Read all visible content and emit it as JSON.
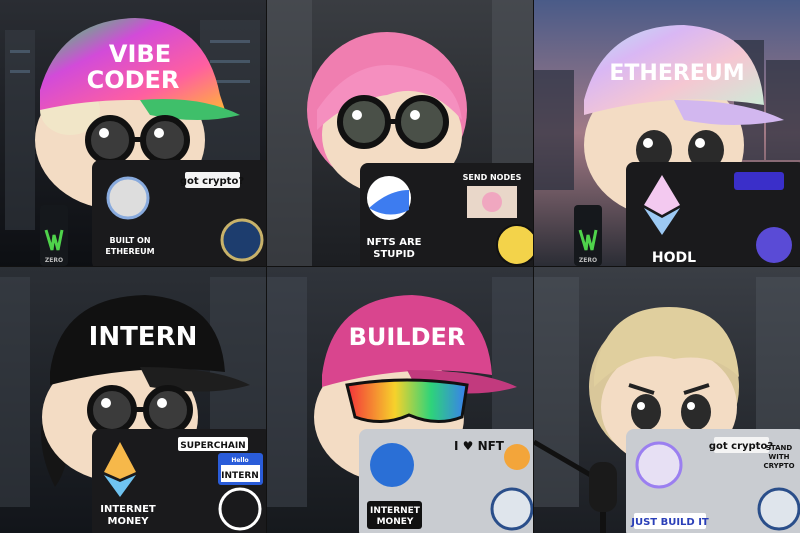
{
  "tiles": [
    {
      "hat": [
        "VIBE",
        "CODER"
      ],
      "stickers": {
        "a": "got crypto?",
        "b": [
          "BUILT ON",
          "ETHEREUM"
        ],
        "can": "ZERO"
      }
    },
    {
      "hat": [],
      "stickers": {
        "a": "SEND NODES",
        "b": [
          "NFTS ARE",
          "STUPID"
        ]
      }
    },
    {
      "hat": [
        "ETHEREUM"
      ],
      "stickers": {
        "a": "HODL",
        "can": "ZERO"
      }
    },
    {
      "hat": [
        "INTERN"
      ],
      "stickers": {
        "a": "SUPERCHAIN",
        "name": "INTERN",
        "nameHeader": "Hello",
        "b": [
          "INTERNET",
          "MONEY"
        ]
      }
    },
    {
      "hat": [
        "BUILDER"
      ],
      "stickers": {
        "a": "I ♥ NFT",
        "b": [
          "INTERNET",
          "MONEY"
        ]
      }
    },
    {
      "hat": [],
      "stickers": {
        "a": "got crypto?",
        "b": [
          "STAND",
          "WITH",
          "CRYPTO"
        ],
        "c": "JUST BUILD IT"
      }
    }
  ],
  "colors": {
    "laptop": "#1a1a1c",
    "laptopSilver": "#c9ccd1",
    "skin": "#f3dcc4"
  }
}
